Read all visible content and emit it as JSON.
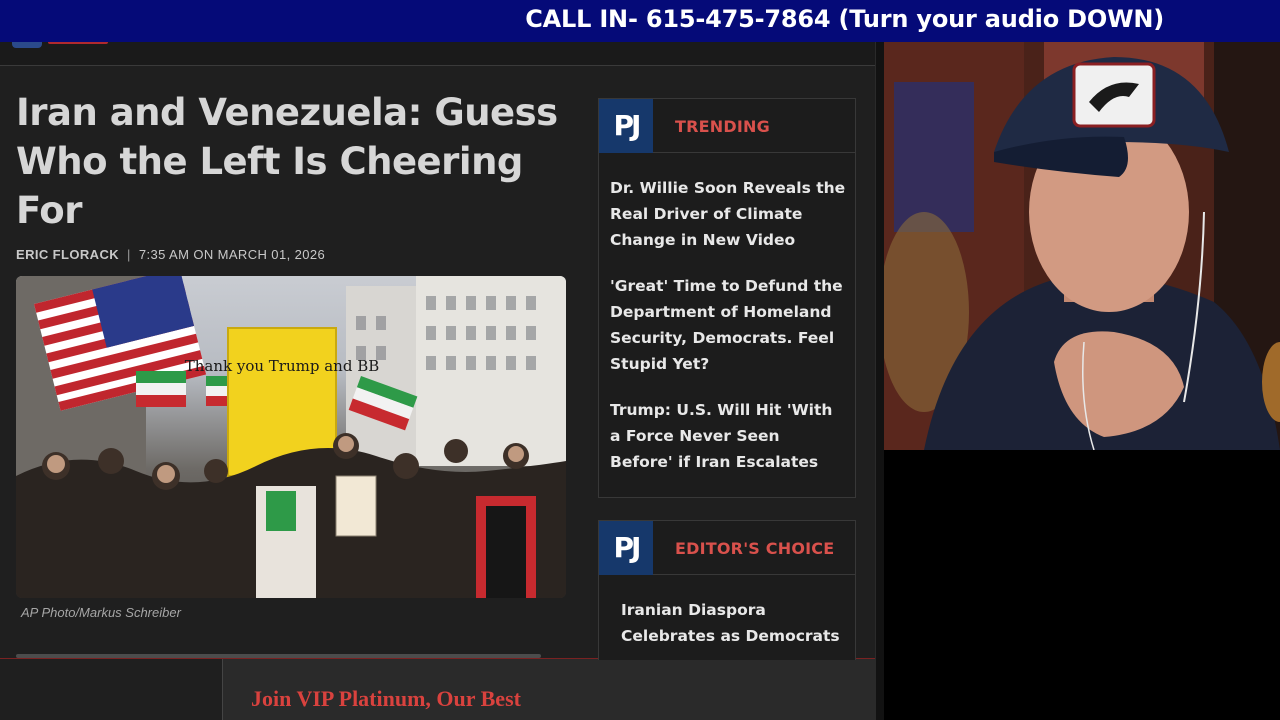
{
  "banner": {
    "text": "CALL IN- 615-475-7864 (Turn your audio DOWN)"
  },
  "article": {
    "headline": "Iran and Venezuela: Guess Who the Left Is Cheering For",
    "author": "ERIC FLORACK",
    "byline_separator": "|",
    "timestamp": "7:35 AM ON MARCH 01, 2026",
    "photo_credit": "AP Photo/Markus Schreiber",
    "photo_sign_text": "Thank you Trump and BB",
    "vip_promo": "Join VIP Platinum, Our Best"
  },
  "sidebar": {
    "trending": {
      "badge": "PJ",
      "title": "TRENDING",
      "items": [
        {
          "label": "Dr. Willie Soon Reveals the Real Driver of Climate Change in New Video"
        },
        {
          "label": "'Great' Time to Defund the Department of Homeland Security, Democrats. Feel Stupid Yet?"
        },
        {
          "label": "Trump: U.S. Will Hit 'With a Force Never Seen Before' if Iran Escalates"
        }
      ]
    },
    "editors_choice": {
      "badge": "PJ",
      "title": "EDITOR'S CHOICE",
      "items": [
        {
          "label": "Iranian Diaspora Celebrates as Democrats"
        }
      ]
    }
  },
  "colors": {
    "banner_bg": "#050a78",
    "page_bg": "#1f1f1f",
    "accent_red": "#d9514c",
    "pj_blue": "#16386b"
  }
}
